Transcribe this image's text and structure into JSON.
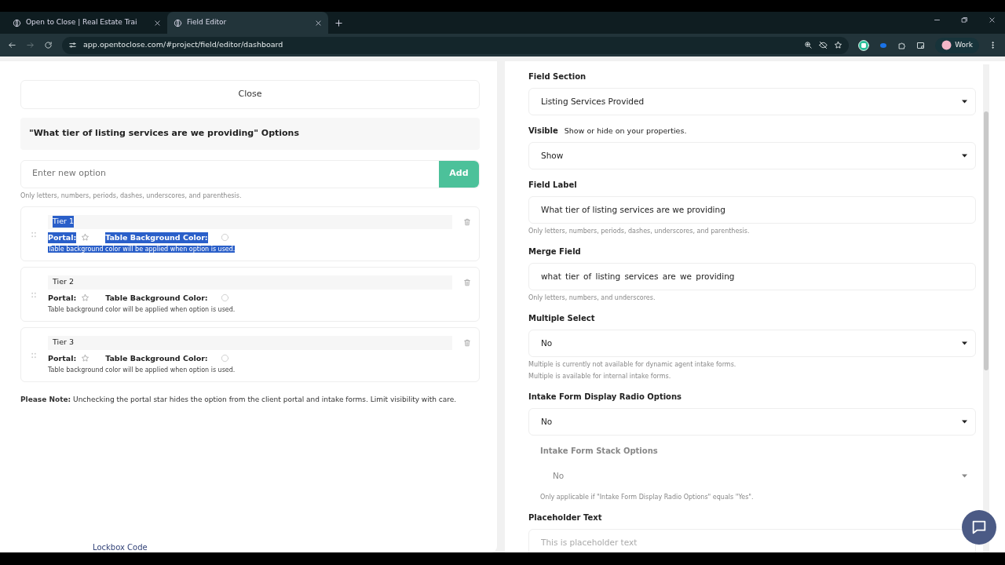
{
  "browser": {
    "tabs": [
      {
        "title": "Open to Close | Real Estate Trai",
        "selected": false
      },
      {
        "title": "Field Editor",
        "selected": true
      }
    ],
    "url": "app.opentoclose.com/#project/field/editor/dashboard",
    "profile": "Work"
  },
  "options_panel": {
    "close_label": "Close",
    "heading": "\"What tier of listing services are we providing\" Options",
    "new_option_placeholder": "Enter new option",
    "add_label": "Add",
    "hint": "Only letters, numbers, periods, dashes, underscores, and parenthesis.",
    "options": [
      {
        "label": "Tier 1",
        "portal_label": "Portal:",
        "portal": false,
        "color_label": "Table Background Color:",
        "note": "Table background color will be applied when option is used.",
        "highlighted": true
      },
      {
        "label": "Tier 2",
        "portal_label": "Portal:",
        "portal": false,
        "color_label": "Table Background Color:",
        "note": "Table background color will be applied when option is used.",
        "highlighted": false
      },
      {
        "label": "Tier 3",
        "portal_label": "Portal:",
        "portal": false,
        "color_label": "Table Background Color:",
        "note": "Table background color will be applied when option is used.",
        "highlighted": false
      }
    ],
    "note": "**Please Note:** Unchecking the portal star hides the option from the client portal and intake forms. Limit visibility with care.",
    "background_item": "Lockbox Code"
  },
  "field_panel": {
    "fields": [
      {
        "kind": "select",
        "label": "Field Section",
        "value": "Listing Services Provided",
        "disabled": false
      },
      {
        "kind": "select",
        "label": "Visible",
        "description": "Show or hide on your properties.",
        "value": "Show",
        "disabled": false
      },
      {
        "kind": "input",
        "label": "Field Label",
        "value": "What tier of listing services are we providing",
        "hints": [
          "Only letters, numbers, periods, dashes, underscores, and parenthesis."
        ]
      },
      {
        "kind": "input",
        "label": "Merge Field",
        "value": "what_tier_of_listing_services_are_we_providing",
        "hints": [
          "Only letters, numbers, and underscores."
        ]
      },
      {
        "kind": "select",
        "label": "Multiple Select",
        "value": "No",
        "disabled": false,
        "hints": [
          "Multiple is currently not available for dynamic agent intake forms.",
          "Multiple is available for internal intake forms."
        ]
      },
      {
        "kind": "select",
        "label": "Intake Form Display Radio Options",
        "value": "No",
        "disabled": false
      },
      {
        "kind": "select",
        "label": "Intake Form Stack Options",
        "value": "No",
        "disabled": true,
        "hints": [
          "Only applicable if \"Intake Form Display Radio Options\" equals \"Yes\"."
        ]
      },
      {
        "kind": "input",
        "label": "Placeholder Text",
        "placeholder": "This is placeholder text"
      }
    ]
  }
}
